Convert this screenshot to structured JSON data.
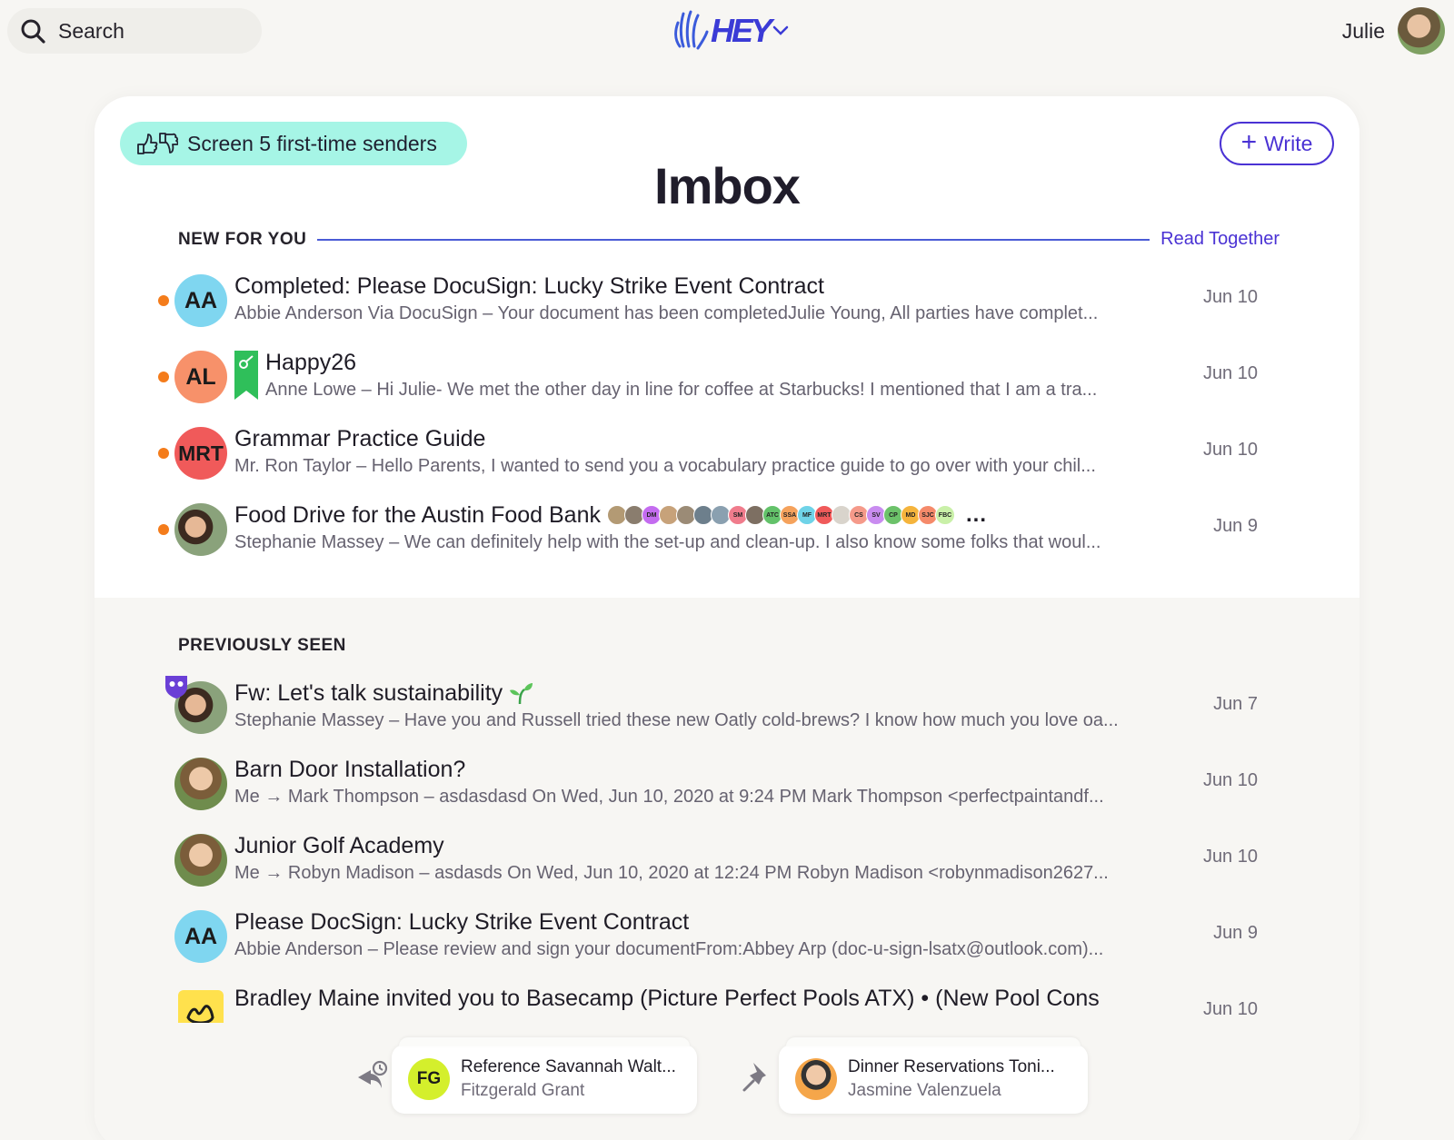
{
  "topbar": {
    "search_label": "Search",
    "logo_text": "HEY",
    "user_name": "Julie"
  },
  "header": {
    "screen_button": "Screen 5 first-time senders",
    "write_label": "Write",
    "title": "Imbox"
  },
  "new_for_you": {
    "label": "NEW FOR YOU",
    "read_together": "Read Together",
    "items": [
      {
        "avatar": "AA",
        "avatar_color": "#7fd6f0",
        "subject": "Completed: Please DocuSign: Lucky Strike Event Contract",
        "snippet": "Abbie Anderson Via DocuSign – Your document has been completedJulie Young, All parties have complet...",
        "date": "Jun 10"
      },
      {
        "avatar": "AL",
        "avatar_color": "#f7916a",
        "subject": "Happy26",
        "snippet": "Anne Lowe – Hi Julie- We met the other day in line for coffee at Starbucks! I mentioned that I am a tra...",
        "date": "Jun 10"
      },
      {
        "avatar": "MRT",
        "avatar_color": "#f05a5a",
        "subject": "Grammar Practice Guide",
        "snippet": "Mr. Ron Taylor – Hello Parents, I wanted to send you a vocabulary practice guide to go over with your chil...",
        "date": "Jun 10"
      },
      {
        "subject": "Food Drive for the Austin Food Bank",
        "snippet": "Stephanie Massey – We can definitely help with the set-up and clean-up. I also know some folks that woul...",
        "date": "Jun 9",
        "participants": [
          {
            "initials": "",
            "color": "#b39a74"
          },
          {
            "initials": "",
            "color": "#8a7d6e"
          },
          {
            "initials": "DM",
            "color": "#c46cf0"
          },
          {
            "initials": "",
            "color": "#c7a27a"
          },
          {
            "initials": "",
            "color": "#9b8b76"
          },
          {
            "initials": "",
            "color": "#6d7f8c"
          },
          {
            "initials": "",
            "color": "#8aa0b0"
          },
          {
            "initials": "SM",
            "color": "#f07c8c"
          },
          {
            "initials": "",
            "color": "#7d6f62"
          },
          {
            "initials": "ATC",
            "color": "#63c26a"
          },
          {
            "initials": "SSA",
            "color": "#f5a25c"
          },
          {
            "initials": "MF",
            "color": "#6fd3e8"
          },
          {
            "initials": "MRT",
            "color": "#f05a5a"
          },
          {
            "initials": "",
            "color": "#d9d4cc"
          },
          {
            "initials": "CS",
            "color": "#f59a8a"
          },
          {
            "initials": "SV",
            "color": "#c98cf0"
          },
          {
            "initials": "CP",
            "color": "#6cc26a"
          },
          {
            "initials": "MD",
            "color": "#f5b43c"
          },
          {
            "initials": "SJC",
            "color": "#f58a6a"
          },
          {
            "initials": "FBC",
            "color": "#c9f0a8"
          }
        ],
        "more": "..."
      }
    ]
  },
  "previously_seen": {
    "label": "PREVIOUSLY SEEN",
    "items": [
      {
        "subject": "Fw: Let's talk sustainability",
        "snippet": "Stephanie Massey – Have you and Russell tried these new Oatly cold-brews? I know how much you love oa...",
        "date": "Jun 7"
      },
      {
        "subject": "Barn Door Installation?",
        "snippet": "Me → Mark Thompson – asdasdasd On Wed, Jun 10, 2020 at 9:24 PM Mark Thompson <perfectpaintandf...",
        "date": "Jun 10"
      },
      {
        "subject": "Junior Golf Academy",
        "snippet": "Me → Robyn Madison – asdasds On Wed, Jun 10, 2020 at 12:24 PM Robyn Madison <robynmadison2627...",
        "date": "Jun 10"
      },
      {
        "avatar": "AA",
        "avatar_color": "#7fd6f0",
        "subject": "Please DocSign: Lucky Strike Event Contract",
        "snippet": "Abbie Anderson – Please review and sign your documentFrom:Abbey Arp (doc-u-sign-lsatx@outlook.com)...",
        "date": "Jun 9"
      },
      {
        "subject": "Bradley Maine invited you to Basecamp (Picture Perfect Pools ATX) • (New Pool Cons",
        "snippet": "",
        "date": "Jun 10"
      }
    ]
  },
  "tray": {
    "reply_later": {
      "avatar": "FG",
      "avatar_color": "#d4ef2c",
      "title": "Reference Savannah Walt...",
      "sub": "Fitzgerald Grant"
    },
    "set_aside": {
      "title": "Dinner Reservations Toni...",
      "sub": "Jasmine Valenzuela"
    }
  }
}
